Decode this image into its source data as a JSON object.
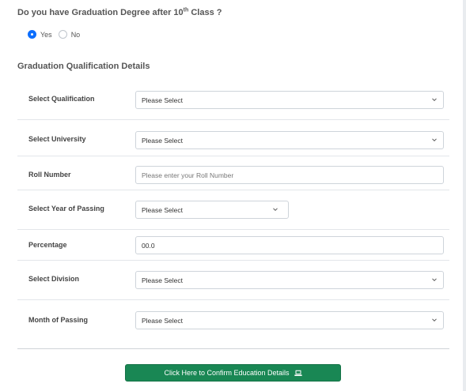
{
  "question": {
    "prefix": "Do you have Graduation Degree after 10",
    "sup": "th",
    "suffix": " Class ?"
  },
  "graduation_radio": {
    "options": [
      {
        "label": "Yes",
        "checked": true
      },
      {
        "label": "No",
        "checked": false
      }
    ]
  },
  "section": {
    "title": "Graduation Qualification Details"
  },
  "fields": {
    "qualification": {
      "label": "Select Qualification",
      "value": "Please Select"
    },
    "university": {
      "label": "Select University",
      "value": "Please Select"
    },
    "roll_number": {
      "label": "Roll Number",
      "placeholder": "Please enter your Roll Number"
    },
    "year_of_passing": {
      "label": "Select Year of Passing",
      "value": "Please Select"
    },
    "percentage": {
      "label": "Percentage",
      "value": "00.0"
    },
    "division": {
      "label": "Select Division",
      "value": "Please Select"
    },
    "month_of_passing": {
      "label": "Month of Passing",
      "value": "Please Select"
    }
  },
  "confirm_button": {
    "label": "Click Here to Confirm Education Details",
    "icon": "laptop-icon",
    "color": "#198754"
  },
  "colors": {
    "accent": "#0d6efd",
    "success": "#198754"
  }
}
